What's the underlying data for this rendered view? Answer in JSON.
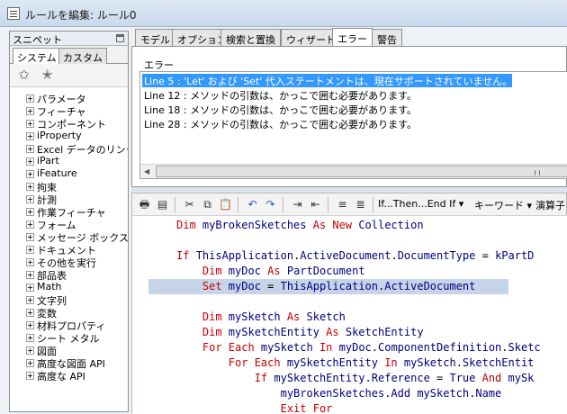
{
  "window": {
    "title": "ルールを編集: ルール0"
  },
  "snippets": {
    "header": "スニペット",
    "tabs": [
      {
        "label": "システム",
        "active": true
      },
      {
        "label": "カスタム",
        "active": false
      }
    ],
    "tree": [
      "パラメータ",
      "フィーチャ",
      "コンポーネント",
      "iProperty",
      "Excel データのリンク",
      "iPart",
      "iFeature",
      "拘束",
      "計測",
      "作業フィーチャ",
      "フォーム",
      "メッセージ ボックス",
      "ドキュメント",
      "その他を実行",
      "部品表",
      "Math",
      "文字列",
      "変数",
      "材料プロパティ",
      "シート メタル",
      "図面",
      "高度な図面 API",
      "高度な API"
    ]
  },
  "tabs": [
    {
      "label": "モデル",
      "active": false
    },
    {
      "label": "オプション",
      "active": false
    },
    {
      "label": "検索と置換",
      "active": false
    },
    {
      "label": "ウィザード",
      "active": false
    },
    {
      "label": "エラー",
      "active": true
    },
    {
      "label": "警告",
      "active": false
    }
  ],
  "errors": {
    "label": "エラー",
    "rows": [
      "Line 5 : 'Let' および 'Set' 代入ステートメントは、現在サポートされていません。",
      "Line 12 : メソッドの引数は、かっこで囲む必要があります。",
      "Line 18 : メソッドの引数は、かっこで囲む必要があります。",
      "Line 28 : メソッドの引数は、かっこで囲む必要があります。"
    ],
    "selected_index": 0
  },
  "toolbar": {
    "if_dropdown": "If...Then...End If",
    "keyword_dropdown": "キーワード",
    "operator_dropdown": "演算子"
  },
  "code": [
    [
      {
        "t": "Dim ",
        "c": "kw"
      },
      {
        "t": "myBrokenSketches ",
        "c": "id"
      },
      {
        "t": "As New ",
        "c": "kw"
      },
      {
        "t": "Collection",
        "c": "id"
      }
    ],
    [],
    [
      {
        "t": "If ",
        "c": "kw"
      },
      {
        "t": "ThisApplication",
        "c": "id"
      },
      {
        "t": ".",
        "c": "op"
      },
      {
        "t": "ActiveDocument",
        "c": "id"
      },
      {
        "t": ".",
        "c": "op"
      },
      {
        "t": "DocumentType ",
        "c": "id"
      },
      {
        "t": "= ",
        "c": "op"
      },
      {
        "t": "kPartD",
        "c": "id"
      }
    ],
    [
      {
        "t": "    Dim ",
        "c": "kw"
      },
      {
        "t": "myDoc ",
        "c": "id"
      },
      {
        "t": "As ",
        "c": "kw"
      },
      {
        "t": "PartDocument",
        "c": "id"
      }
    ],
    [
      {
        "t": "    Set ",
        "c": "kw"
      },
      {
        "t": "myDoc ",
        "c": "id"
      },
      {
        "t": "= ",
        "c": "op"
      },
      {
        "t": "ThisApplication",
        "c": "id"
      },
      {
        "t": ".",
        "c": "op"
      },
      {
        "t": "ActiveDocument",
        "c": "id"
      }
    ],
    [],
    [
      {
        "t": "    Dim ",
        "c": "kw"
      },
      {
        "t": "mySketch ",
        "c": "id"
      },
      {
        "t": "As ",
        "c": "kw"
      },
      {
        "t": "Sketch",
        "c": "id"
      }
    ],
    [
      {
        "t": "    Dim ",
        "c": "kw"
      },
      {
        "t": "mySketchEntity ",
        "c": "id"
      },
      {
        "t": "As ",
        "c": "kw"
      },
      {
        "t": "SketchEntity",
        "c": "id"
      }
    ],
    [
      {
        "t": "    For Each ",
        "c": "kw"
      },
      {
        "t": "mySketch ",
        "c": "id"
      },
      {
        "t": "In ",
        "c": "kw"
      },
      {
        "t": "myDoc",
        "c": "id"
      },
      {
        "t": ".",
        "c": "op"
      },
      {
        "t": "ComponentDefinition",
        "c": "id"
      },
      {
        "t": ".",
        "c": "op"
      },
      {
        "t": "Sketc",
        "c": "id"
      }
    ],
    [
      {
        "t": "        For Each ",
        "c": "kw"
      },
      {
        "t": "mySketchEntity ",
        "c": "id"
      },
      {
        "t": "In ",
        "c": "kw"
      },
      {
        "t": "mySketch",
        "c": "id"
      },
      {
        "t": ".",
        "c": "op"
      },
      {
        "t": "SketchEntit",
        "c": "id"
      }
    ],
    [
      {
        "t": "            If ",
        "c": "kw"
      },
      {
        "t": "mySketchEntity",
        "c": "id"
      },
      {
        "t": ".",
        "c": "op"
      },
      {
        "t": "Reference ",
        "c": "id"
      },
      {
        "t": "= ",
        "c": "op"
      },
      {
        "t": "True ",
        "c": "id"
      },
      {
        "t": "And ",
        "c": "kw"
      },
      {
        "t": "mySk",
        "c": "id"
      }
    ],
    [
      {
        "t": "                myBrokenSketches",
        "c": "id"
      },
      {
        "t": ".",
        "c": "op"
      },
      {
        "t": "Add ",
        "c": "id"
      },
      {
        "t": "mySketch",
        "c": "id"
      },
      {
        "t": ".",
        "c": "op"
      },
      {
        "t": "Name",
        "c": "id"
      }
    ],
    [
      {
        "t": "                Exit For",
        "c": "kw"
      }
    ]
  ],
  "highlighted_line": 4
}
